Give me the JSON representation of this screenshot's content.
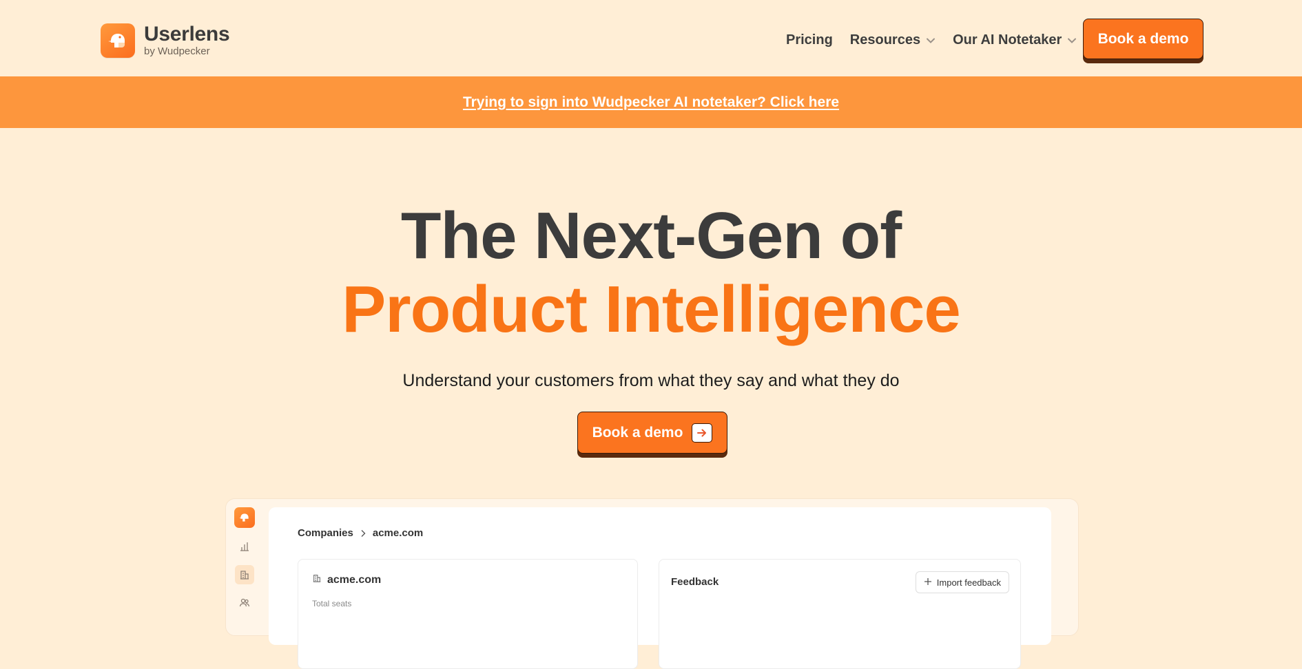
{
  "brand": {
    "name": "Userlens",
    "sub": "by Wudpecker",
    "logo_icon": "woodpecker-logo-icon",
    "accent": "#fb741f"
  },
  "nav": {
    "links": [
      {
        "label": "Pricing",
        "dropdown": false
      },
      {
        "label": "Resources",
        "dropdown": true
      },
      {
        "label": "Our AI Notetaker",
        "dropdown": true
      }
    ],
    "cta_label": "Book a demo"
  },
  "banner": {
    "text": "Trying to sign into Wudpecker AI notetaker? Click here",
    "color": "#fd963d"
  },
  "hero": {
    "line1": "The Next-Gen of",
    "line2": "Product Intelligence",
    "subtitle": "Understand your customers from what they say and what they do",
    "cta_label": "Book a demo",
    "cta_icon": "arrow-right-icon",
    "highlight_color": "#f97416"
  },
  "preview": {
    "rail_icons": [
      "bar-chart-icon",
      "building-icon",
      "users-icon"
    ],
    "breadcrumb": [
      "Companies",
      "acme.com"
    ],
    "company_card": {
      "title": "acme.com",
      "label": "Total seats"
    },
    "feedback_card": {
      "title": "Feedback",
      "button_label": "Import feedback"
    }
  }
}
